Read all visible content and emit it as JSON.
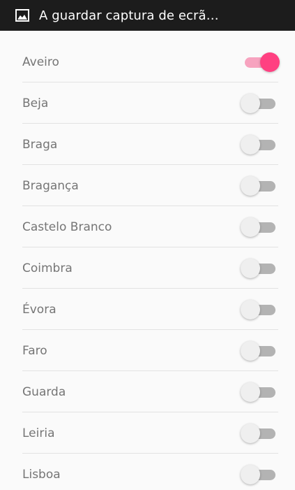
{
  "status_bar": {
    "icon": "image-icon",
    "text": "A guardar captura de ecrã…"
  },
  "colors": {
    "accent": "#ff4081",
    "accent_track": "#f7a3bf",
    "off_track": "#b3b3b3",
    "off_thumb": "#efefef",
    "label": "#757575",
    "divider": "#e2e2e2",
    "status_bar": "#1c1c1c"
  },
  "districts": [
    {
      "label": "Aveiro",
      "enabled": true
    },
    {
      "label": "Beja",
      "enabled": false
    },
    {
      "label": "Braga",
      "enabled": false
    },
    {
      "label": "Bragança",
      "enabled": false
    },
    {
      "label": "Castelo Branco",
      "enabled": false
    },
    {
      "label": "Coimbra",
      "enabled": false
    },
    {
      "label": "Évora",
      "enabled": false
    },
    {
      "label": "Faro",
      "enabled": false
    },
    {
      "label": "Guarda",
      "enabled": false
    },
    {
      "label": "Leiria",
      "enabled": false
    },
    {
      "label": "Lisboa",
      "enabled": false
    }
  ]
}
